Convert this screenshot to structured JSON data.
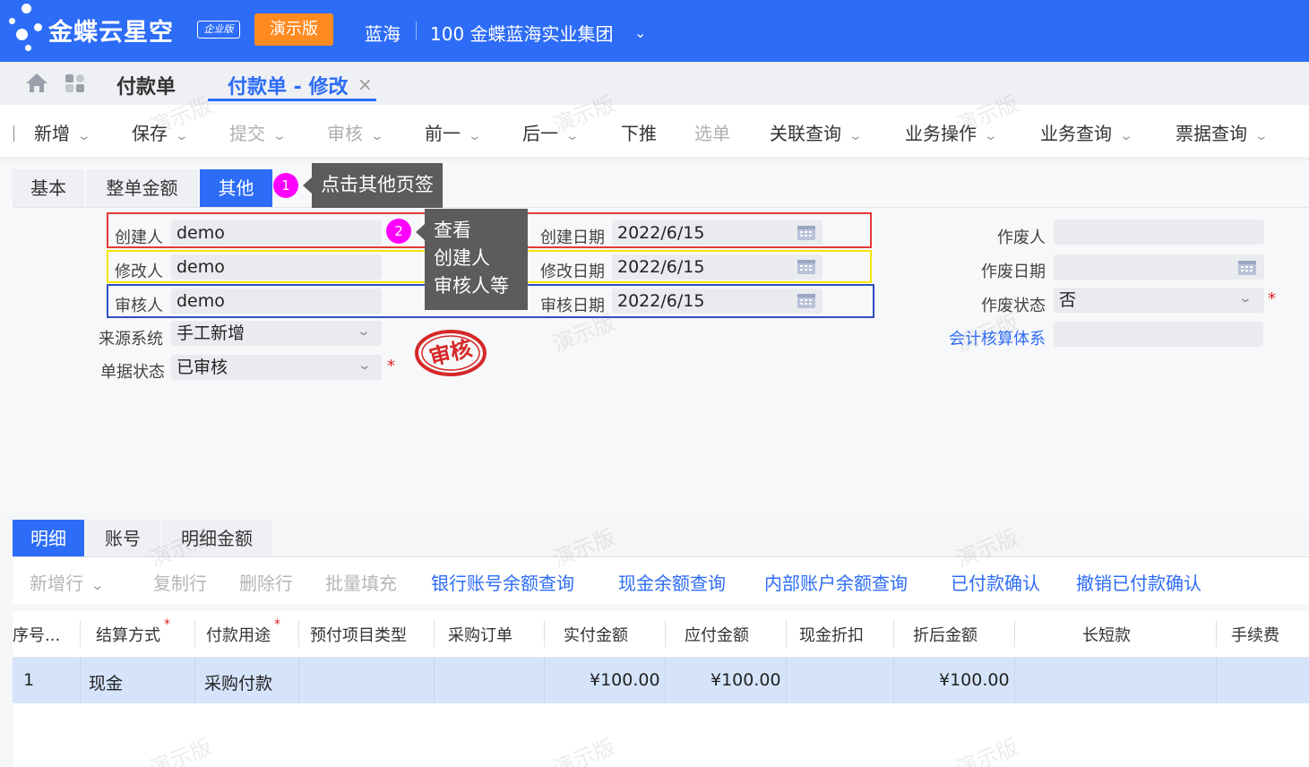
{
  "header": {
    "brand": "金蝶云星空",
    "edition": "企业版",
    "demo_label": "演示版",
    "org": "蓝海",
    "company": "100 金蝶蓝海实业集团"
  },
  "tabs": {
    "list": "付款单",
    "edit": "付款单 - 修改",
    "close": "×"
  },
  "toolbar": {
    "new": "新增",
    "save": "保存",
    "submit": "提交",
    "audit": "审核",
    "prev": "前一",
    "next": "后一",
    "push": "下推",
    "select": "选单",
    "related": "关联查询",
    "business_op": "业务操作",
    "business_query": "业务查询",
    "invoice_query": "票据查询"
  },
  "subtabs": {
    "basic": "基本",
    "amount": "整单金额",
    "other": "其他"
  },
  "annotations": {
    "step1_num": "1",
    "step1_text": "点击其他页签",
    "step2_num": "2",
    "step2_line1": "查看",
    "step2_line2": "创建人",
    "step2_line3": "审核人等",
    "colors": {
      "red_box": "#e53935",
      "yellow_box": "#f5e400",
      "blue_box": "#2e4fc4"
    }
  },
  "form": {
    "creator_label": "创建人",
    "creator": "demo",
    "modifier_label": "修改人",
    "modifier": "demo",
    "auditor_label": "审核人",
    "auditor": "demo",
    "source_label": "来源系统",
    "source": "手工新增",
    "status_label": "单据状态",
    "status": "已审核",
    "create_date_label": "创建日期",
    "create_date": "2022/6/15",
    "modify_date_label": "修改日期",
    "modify_date": "2022/6/15",
    "audit_date_label": "审核日期",
    "audit_date": "2022/6/15",
    "void_by_label": "作废人",
    "void_by": "",
    "void_date_label": "作废日期",
    "void_date": "",
    "void_status_label": "作废状态",
    "void_status": "否",
    "accounting_label": "会计核算体系",
    "accounting": "",
    "stamp_text": "审核",
    "required": "*"
  },
  "detail": {
    "tabs": {
      "detail": "明细",
      "account": "账号",
      "detail_amount": "明细金额"
    },
    "toolbar": {
      "add_row": "新增行",
      "copy_row": "复制行",
      "delete_row": "删除行",
      "batch_fill": "批量填充",
      "bank_balance": "银行账号余额查询",
      "cash_balance": "现金余额查询",
      "internal_balance": "内部账户余额查询",
      "paid_confirm": "已付款确认",
      "cancel_paid_confirm": "撤销已付款确认"
    },
    "columns": [
      "序号...",
      "结算方式",
      "付款用途",
      "预付项目类型",
      "采购订单",
      "实付金额",
      "应付金额",
      "现金折扣",
      "折后金额",
      "长短款",
      "手续费"
    ],
    "rows": [
      {
        "seq": "1",
        "settle": "现金",
        "purpose": "采购付款",
        "prepay_type": "",
        "po": "",
        "paid": "¥100.00",
        "payable": "¥100.00",
        "discount": "",
        "after_discount": "¥100.00",
        "diff": "",
        "fee": ""
      }
    ]
  },
  "watermark": "演示版"
}
